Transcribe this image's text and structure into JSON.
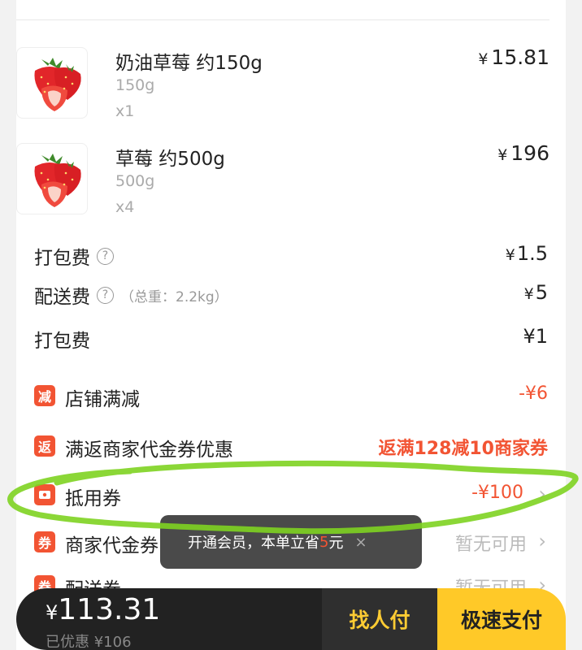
{
  "products": [
    {
      "name": "奶油草莓 约150g",
      "spec": "150g",
      "qty": "x1",
      "currency": "¥",
      "price": "15.81",
      "icon": "strawberry-image"
    },
    {
      "name": "草莓 约500g",
      "spec": "500g",
      "qty": "x4",
      "currency": "¥",
      "price": "196",
      "icon": "strawberry-image"
    }
  ],
  "fees": {
    "packing": {
      "label": "打包费",
      "currency": "¥",
      "value": "1.5"
    },
    "delivery": {
      "label": "配送费",
      "note": "（总重：2.2kg）",
      "currency": "¥",
      "value": "5"
    },
    "packing2": {
      "label": "打包费",
      "value": "¥1"
    }
  },
  "promos": {
    "store_discount": {
      "badge": "减",
      "label": "店铺满减",
      "value": "-¥6"
    },
    "cashback": {
      "badge": "返",
      "label": "满返商家代金券优惠",
      "value": "返满128减10商家券"
    },
    "coupon": {
      "label": "抵用券",
      "value": "-¥100"
    },
    "merchant_voucher": {
      "badge": "券",
      "label": "商家代金券",
      "value": "暂无可用"
    },
    "delivery_voucher": {
      "badge": "券",
      "label": "配送券",
      "value": "暂无可用"
    }
  },
  "toast": {
    "text_before": "开通会员，本单立省",
    "accent": "5",
    "text_after": "元",
    "close": "×"
  },
  "bottom": {
    "currency": "¥",
    "total": "113.31",
    "saved": "已优惠 ¥106",
    "friend_pay": "找人付",
    "fast_pay": "极速支付"
  },
  "colors": {
    "accent": "#f25433",
    "pay_button": "#ffc928",
    "friend_text": "#ffcc33",
    "annotation": "#7ed321"
  }
}
